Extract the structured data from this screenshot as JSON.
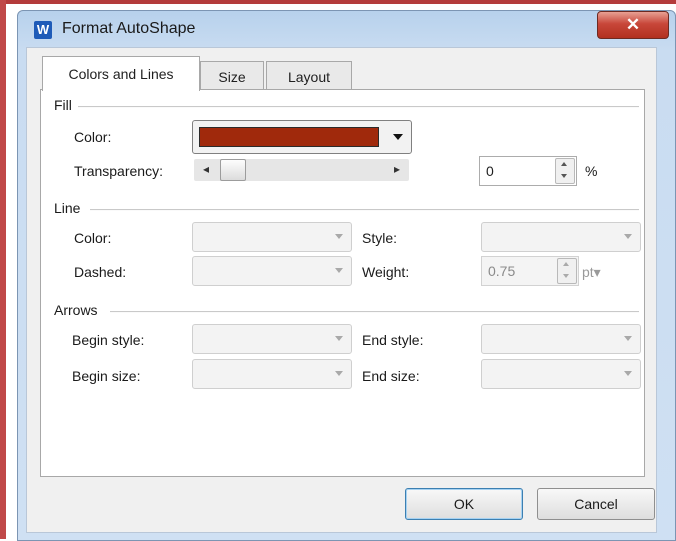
{
  "window": {
    "title": "Format AutoShape",
    "close_label": "✕",
    "app_icon": "W"
  },
  "tabs": [
    {
      "label": "Colors and Lines",
      "active": true
    },
    {
      "label": "Size",
      "active": false
    },
    {
      "label": "Layout",
      "active": false
    }
  ],
  "fill": {
    "section_label": "Fill",
    "color_label": "Color:",
    "color_value": "#a0290c",
    "transparency_label": "Transparency:",
    "transparency_value": "0",
    "percent_label": "%",
    "slider_left": "◂",
    "slider_right": "▸"
  },
  "line": {
    "section_label": "Line",
    "color_label": "Color:",
    "style_label": "Style:",
    "dashed_label": "Dashed:",
    "weight_label": "Weight:",
    "weight_value": "0.75",
    "weight_unit": "pt▾"
  },
  "arrows": {
    "section_label": "Arrows",
    "begin_style_label": "Begin style:",
    "end_style_label": "End style:",
    "begin_size_label": "Begin size:",
    "end_size_label": "End size:"
  },
  "buttons": {
    "ok": "OK",
    "cancel": "Cancel"
  }
}
